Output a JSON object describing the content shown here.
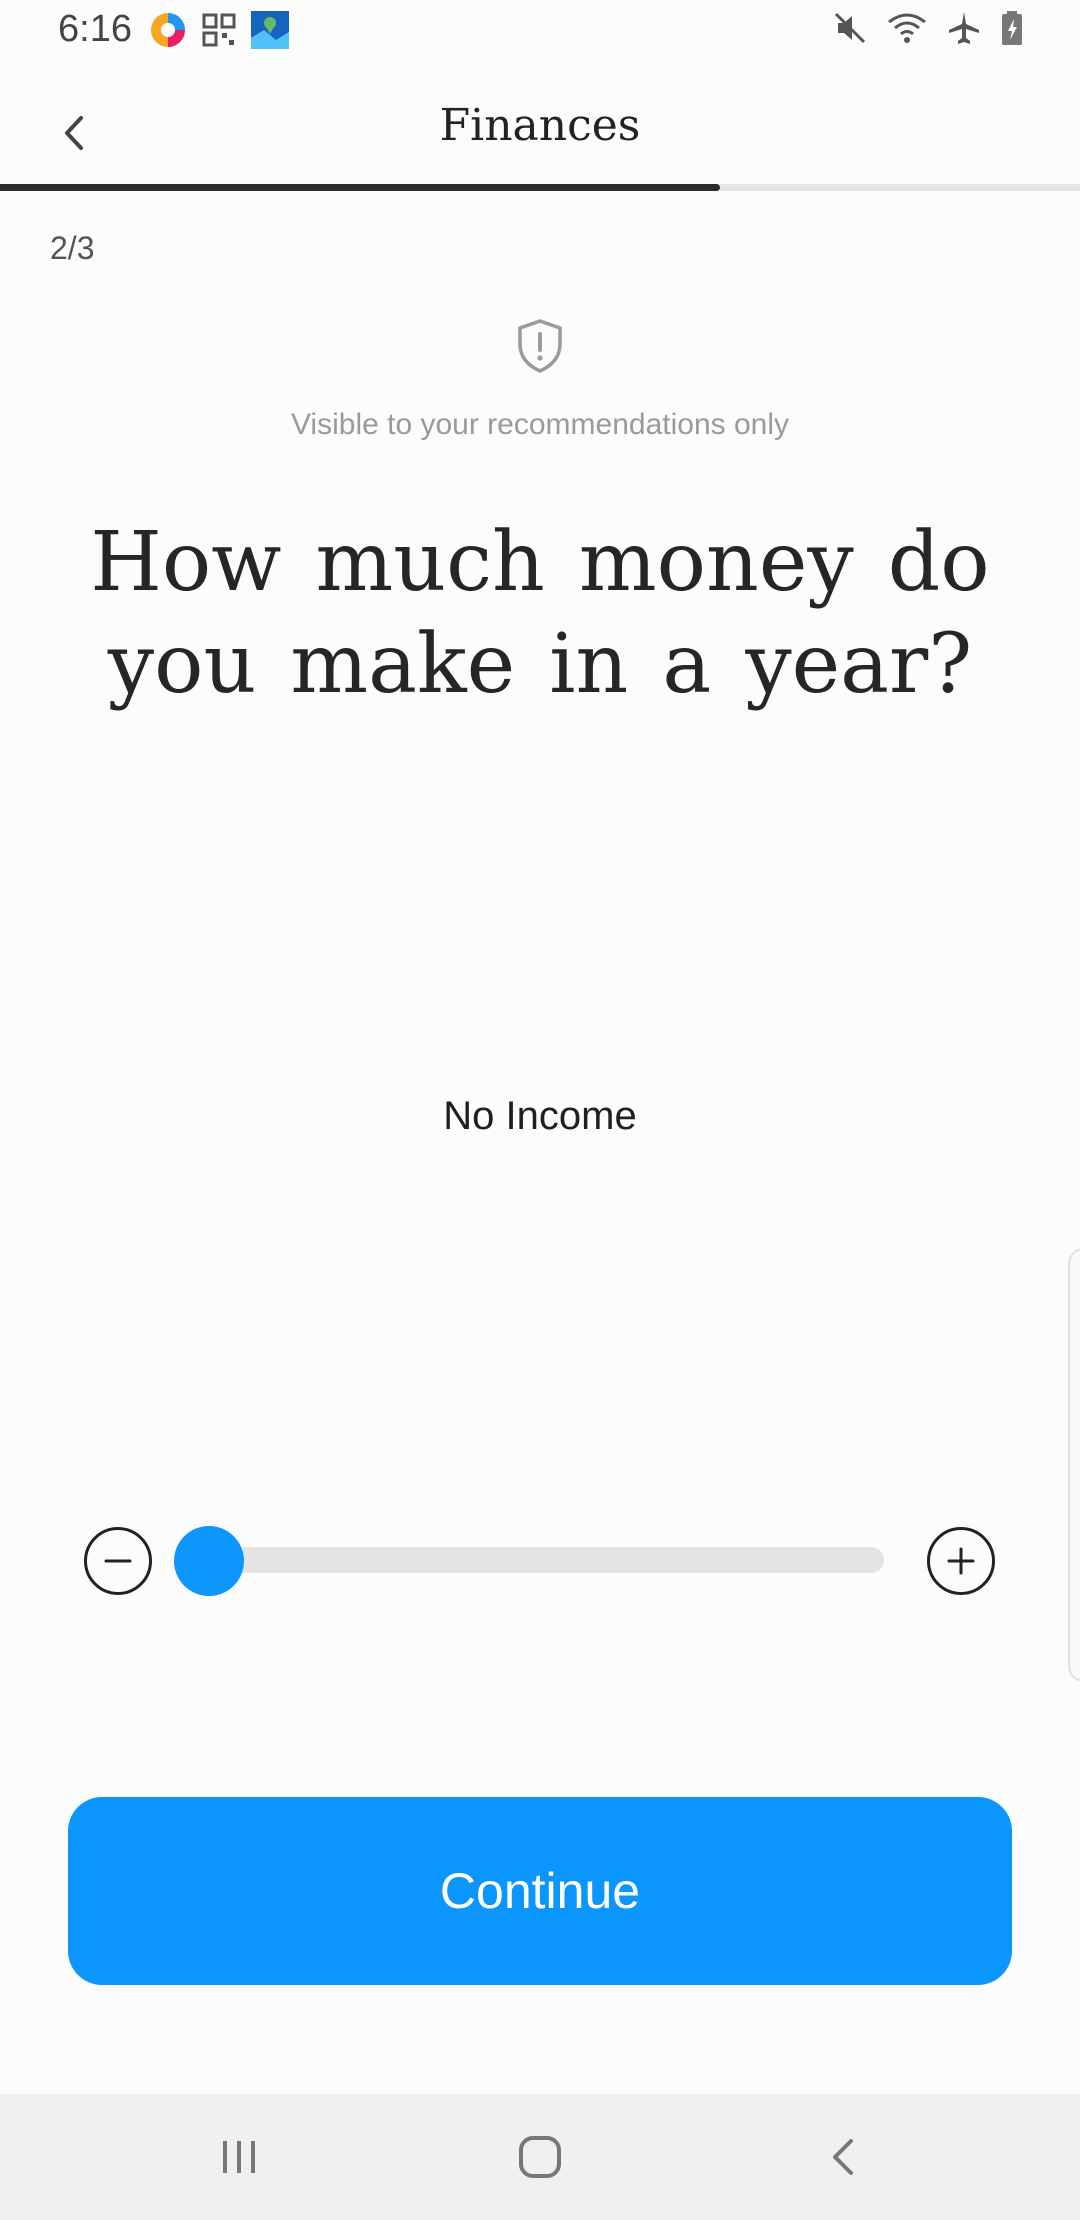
{
  "status_bar": {
    "time": "6:16"
  },
  "header": {
    "title": "Finances"
  },
  "progress": {
    "fraction": 0.667
  },
  "step_counter": "2/3",
  "privacy_note": "Visible to your recommendations only",
  "question": "How much money do you make in a year?",
  "income": {
    "value_label": "No Income",
    "slider_level": 0
  },
  "continue_label": "Continue",
  "colors": {
    "accent": "#0a96fc",
    "progress_fill": "#2c2c2c"
  },
  "icons": {
    "back": "chevron-left-icon",
    "privacy": "shield-alert-icon",
    "minus": "minus-circle-icon",
    "plus": "plus-circle-icon"
  }
}
